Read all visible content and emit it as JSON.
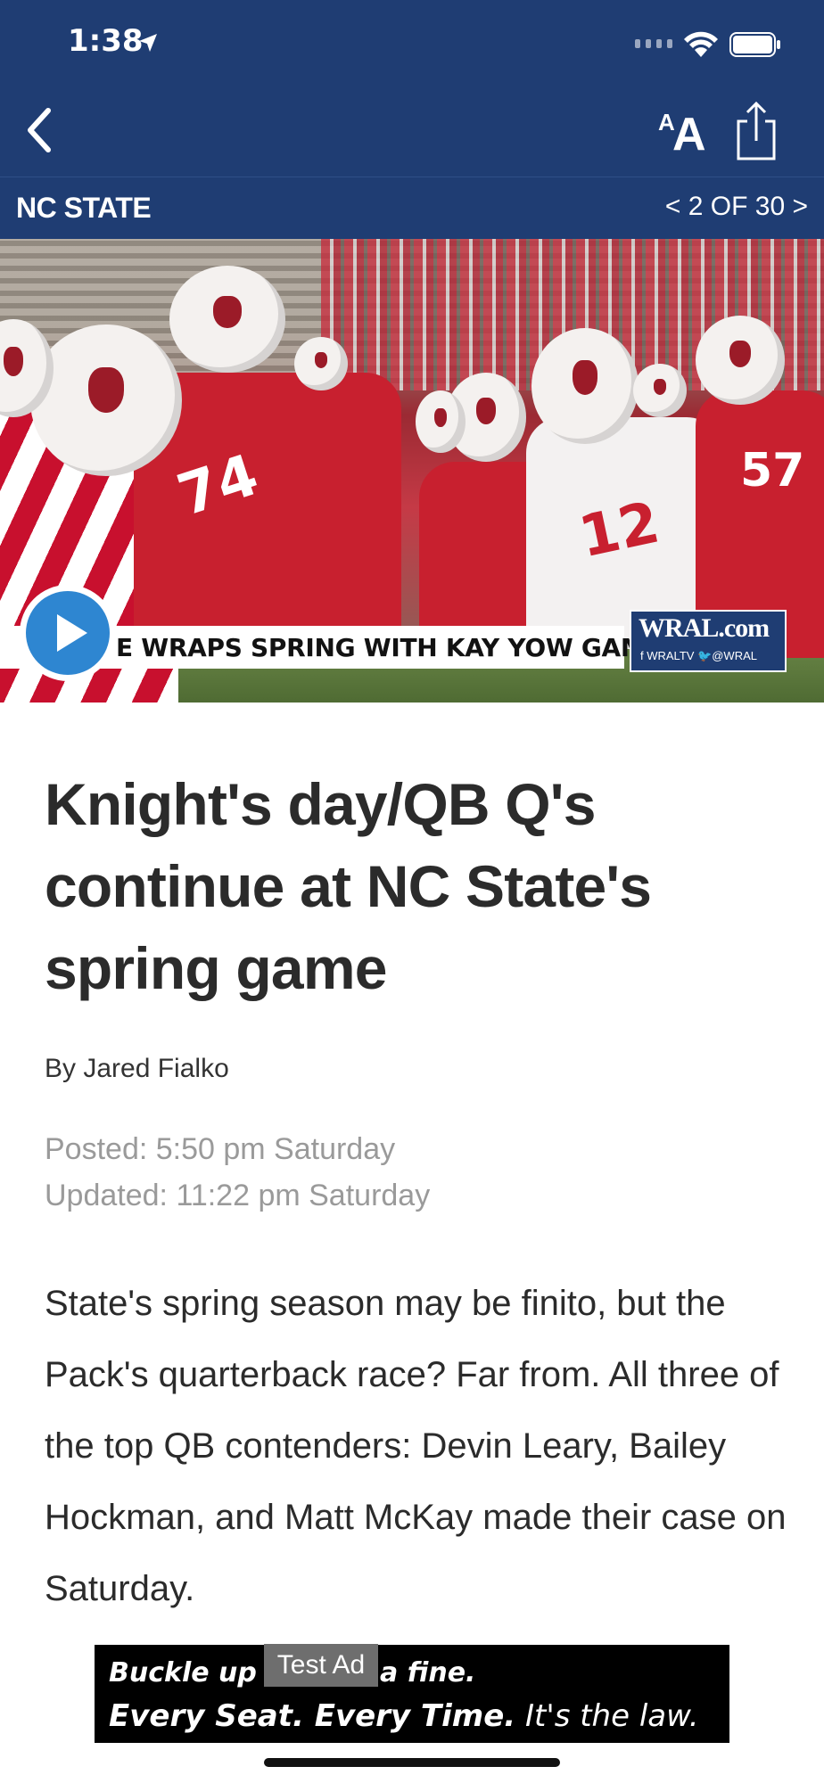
{
  "status_bar": {
    "time": "1:38"
  },
  "nav": {
    "section": "NC STATE",
    "pager": "< 2 OF 30 >"
  },
  "video": {
    "lower_third": "E WRAPS SPRING WITH KAY YOW GAME",
    "brand": "WRAL.com",
    "social": "f WRALTV  🐦@WRAL",
    "jersey_numbers": [
      "74",
      "12",
      "57"
    ]
  },
  "article": {
    "headline": "Knight's day/QB Q's continue at NC State's spring game",
    "byline": "By Jared Fialko",
    "posted": "Posted: 5:50 pm Saturday",
    "updated": "Updated: 11:22 pm Saturday",
    "body": "State's spring season may be finito, but the Pack's quarterback race? Far from. All three of the top QB contenders: Devin Leary, Bailey Hockman, and Matt McKay made their case on Saturday."
  },
  "ad": {
    "label": "Test Ad",
    "line1": "Buckle up or face a fine.",
    "line2_bold": "Every Seat. Every Time.",
    "line2_rest": " It's the law."
  },
  "colors": {
    "nav_bg": "#1f3d73",
    "play_blue": "#2e86d1",
    "state_red": "#c8202f"
  }
}
